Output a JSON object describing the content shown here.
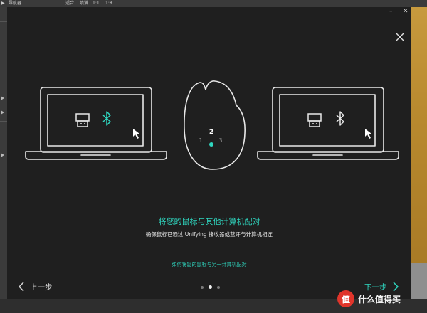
{
  "background": {
    "top_labels": [
      "▶",
      "导航器",
      "适合",
      "填满",
      "1:1",
      "1:8"
    ]
  },
  "dialog": {
    "mouse_channels": [
      "2",
      "1",
      "3"
    ],
    "title": "将您的鼠标与其他计算机配对",
    "subtitle": "确保鼠标已通过 Unifying 接收器或蓝牙与计算机相连",
    "help_link": "如何将您的鼠标与另一计算机配对",
    "prev_label": "上一步",
    "next_label": "下一步",
    "page_indicator": {
      "current": 2,
      "total": 3
    }
  },
  "watermark": {
    "logo_char": "值",
    "text": "什么值得买"
  },
  "colors": {
    "accent": "#2fd6bf",
    "dialog_bg": "#1f1f1f",
    "line": "#e8e8e8"
  }
}
